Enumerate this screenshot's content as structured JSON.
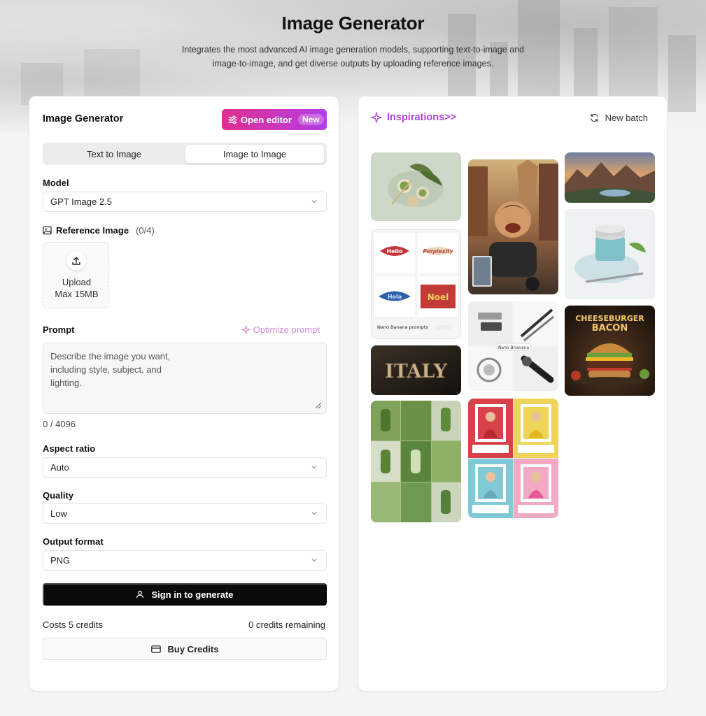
{
  "header": {
    "title": "Image Generator",
    "subtitle": "Integrates the most advanced AI image generation models, supporting text-to-image and image-to-image, and get diverse outputs by uploading reference images."
  },
  "panel": {
    "title": "Image Generator",
    "open_editor_label": "Open editor",
    "new_badge": "New",
    "tabs": [
      {
        "label": "Text to Image",
        "active": false
      },
      {
        "label": "Image to Image",
        "active": true
      }
    ],
    "model": {
      "label": "Model",
      "value": "GPT Image 2.5"
    },
    "reference": {
      "label": "Reference Image",
      "count": "(0/4)",
      "upload_label": "Upload",
      "upload_limit": "Max 15MB"
    },
    "prompt": {
      "label": "Prompt",
      "optimize_label": "Optimize prompt",
      "placeholder": "Describe the image you want, including style, subject, and lighting.",
      "counter": "0 / 4096"
    },
    "aspect_ratio": {
      "label": "Aspect ratio",
      "value": "Auto"
    },
    "quality": {
      "label": "Quality",
      "value": "Low"
    },
    "output_format": {
      "label": "Output format",
      "value": "PNG"
    },
    "signin_label": "Sign in to generate",
    "costs": "Costs 5 credits",
    "remaining": "0 credits remaining",
    "buy_label": "Buy Credits"
  },
  "inspirations": {
    "title": "Inspirations>>",
    "new_batch_label": "New batch",
    "gallery": [
      {
        "name": "matcha-flatlay"
      },
      {
        "name": "scooter-selfie"
      },
      {
        "name": "mountain-sunset"
      },
      {
        "name": "typography-stickers",
        "caption": "Nano Banana prompts",
        "words": [
          "Perplexity"
        ]
      },
      {
        "name": "cosmetic-jar"
      },
      {
        "name": "exploded-gadgets",
        "caption": "Nano Bnanana"
      },
      {
        "name": "cheeseburger-poster",
        "words": [
          "CHEESEBURGER",
          "BACON"
        ]
      },
      {
        "name": "italy-3d-text",
        "words": [
          "ITALY"
        ]
      },
      {
        "name": "green-product-grid"
      },
      {
        "name": "social-frames-collage"
      }
    ]
  },
  "colors": {
    "accent_purple": "#b045d8",
    "editor_gradient_start": "#e0308f",
    "editor_gradient_end": "#b43de6",
    "primary_button": "#0b0b0b"
  }
}
